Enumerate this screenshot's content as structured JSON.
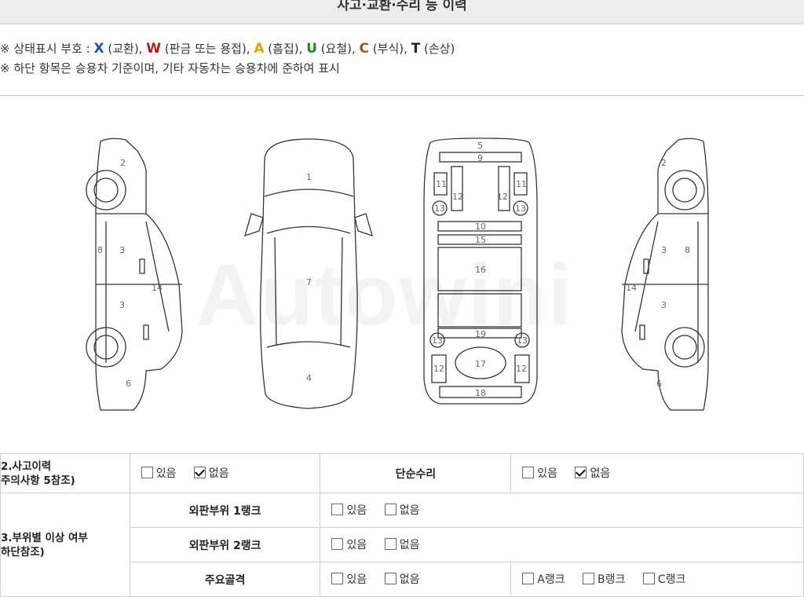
{
  "header": {
    "title": "사고·교환·수리 등 이력"
  },
  "legend": {
    "line1_prefix": "※ 상태표시 부호 : ",
    "items": [
      {
        "sym": "X",
        "text": " (교환), ",
        "color": "#1d4fb0"
      },
      {
        "sym": "W",
        "text": " (판금 또는 용접), ",
        "color": "#b31b1b"
      },
      {
        "sym": "A",
        "text": " (흠집), ",
        "color": "#e0a400"
      },
      {
        "sym": "U",
        "text": " (요철), ",
        "color": "#1d8a1d"
      },
      {
        "sym": "C",
        "text": " (부식), ",
        "color": "#9a5a12"
      },
      {
        "sym": "T",
        "text": " (손상)",
        "color": "#222222"
      }
    ],
    "line2": "※ 하단 항목은 승용차 기준이며, 기타 자동차는 승용차에 준하여 표시"
  },
  "diagram": {
    "watermark": "Autowini",
    "left_side_numbers": [
      "2",
      "8",
      "3",
      "3",
      "14",
      "6"
    ],
    "top_view_numbers": [
      "1",
      "7",
      "4"
    ],
    "under_view_numbers": [
      "5",
      "9",
      "11",
      "12",
      "12",
      "11",
      "13",
      "13",
      "10",
      "15",
      "16",
      "19",
      "13",
      "13",
      "12",
      "17",
      "12",
      "18"
    ],
    "right_side_numbers": [
      "2",
      "3",
      "8",
      "14",
      "3",
      "6"
    ]
  },
  "history": {
    "row1": {
      "label_line1": "2.사고이력",
      "label_line2": "주의사항 5참조)",
      "opt_yes": "있음",
      "opt_no": "없음",
      "mid_label": "단순수리",
      "opt2_yes": "있음",
      "opt2_no": "없음"
    },
    "row_group": {
      "label_line1": "3.부위별 이상 여부",
      "label_line2": "하단참조)",
      "rows": [
        {
          "label": "외판부위 1랭크",
          "yes": "있음",
          "no": "없음"
        },
        {
          "label": "외판부위 2랭크",
          "yes": "있음",
          "no": "없음"
        },
        {
          "label": "주요골격",
          "yes": "있음",
          "no": "없음"
        }
      ],
      "ranks": [
        "A랭크",
        "B랭크",
        "C랭크"
      ]
    }
  }
}
